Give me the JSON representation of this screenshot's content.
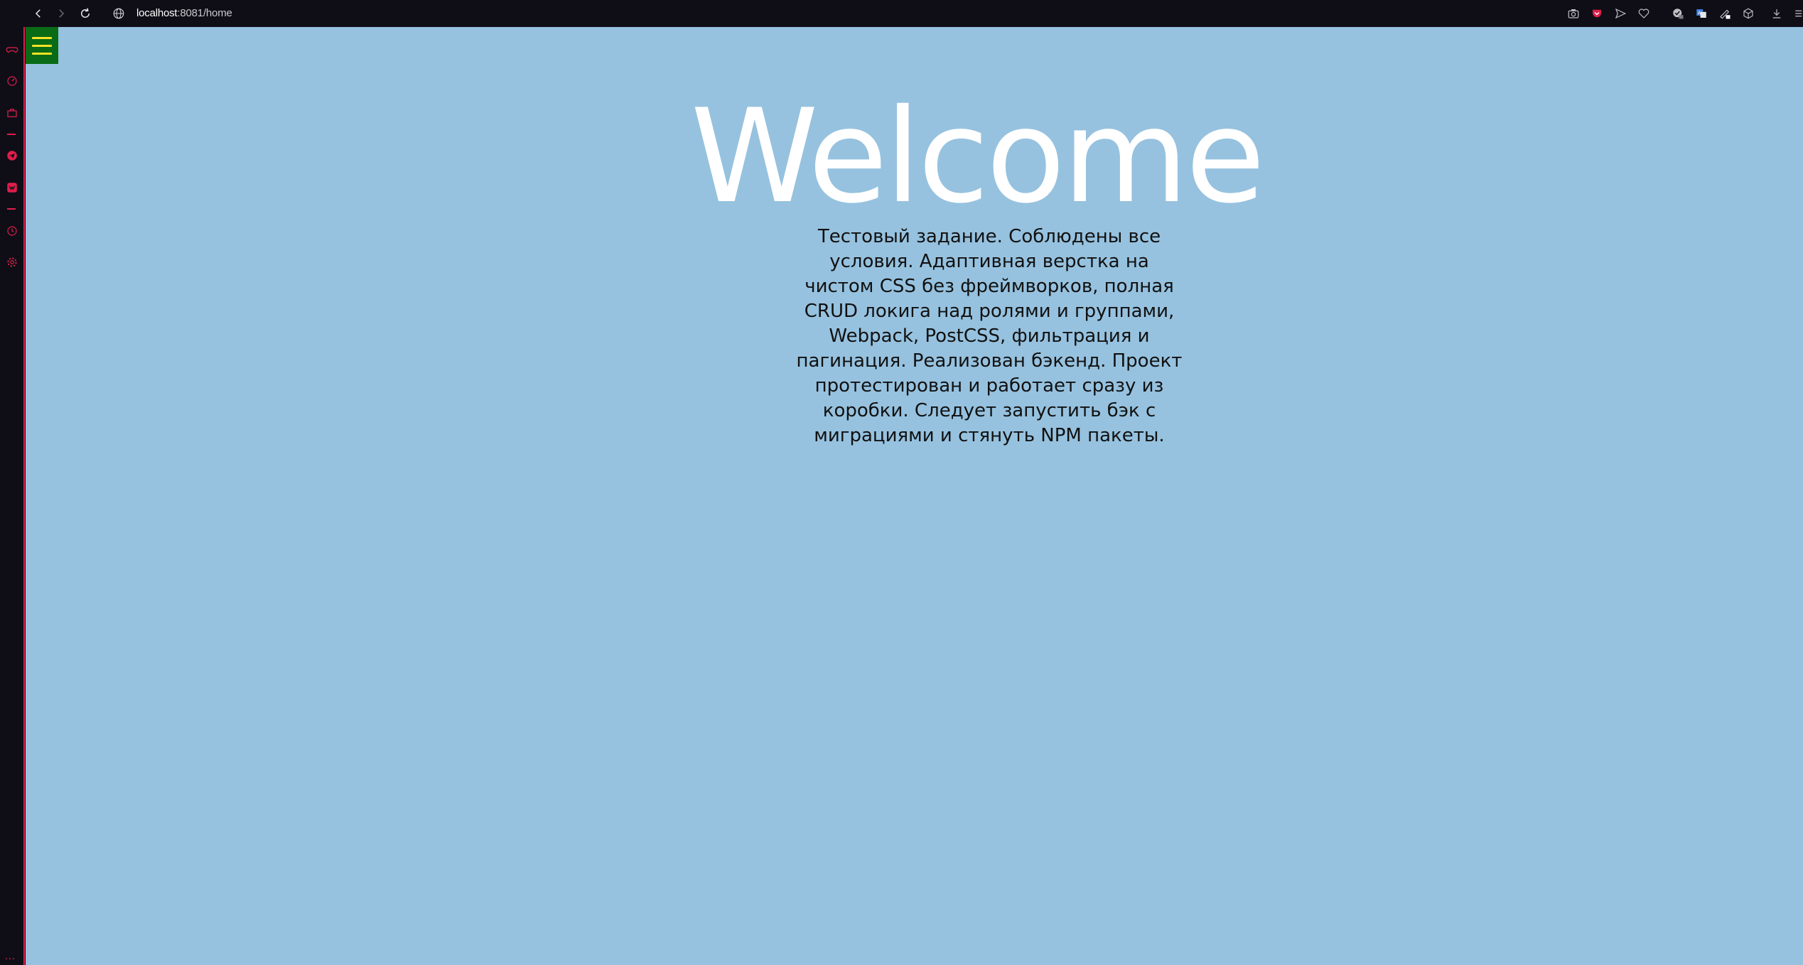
{
  "browser": {
    "url_host": "localhost",
    "url_path": ":8081/home",
    "toolbar_icons": [
      "camera-icon",
      "pocket-icon",
      "send-icon",
      "heart-icon",
      "extension-badge-icon",
      "translate-icon",
      "edit-icon",
      "cube-icon",
      "download-icon",
      "menu-icon"
    ],
    "nav_icons": [
      "back-icon",
      "forward-icon",
      "reload-icon",
      "globe-icon"
    ]
  },
  "sidebar": {
    "items": [
      {
        "name": "gamepad-icon"
      },
      {
        "name": "speed-dial-icon"
      },
      {
        "name": "briefcase-icon"
      },
      {
        "name": "telegram-icon"
      },
      {
        "name": "vk-icon"
      },
      {
        "name": "history-icon"
      },
      {
        "name": "settings-icon"
      }
    ],
    "more_label": "…"
  },
  "page": {
    "title": "Welcome",
    "description": "Тестовый задание. Соблюдены все условия. Адаптивная верстка на чистом CSS без фреймворков, полная CRUD локига над ролями и группами, Webpack, PostCSS, фильтрация и пагинация. Реализован бэкенд. Проект протестирован и работает сразу из коробки. Следует запустить бэк с миграциями и стянуть NPM пакеты."
  },
  "colors": {
    "page_background": "#96c2df",
    "hamburger_background": "#0a6b16",
    "hamburger_bars": "#f4e225",
    "sidebar_accent": "#e01e4b",
    "browser_chrome": "#0f0e17"
  }
}
